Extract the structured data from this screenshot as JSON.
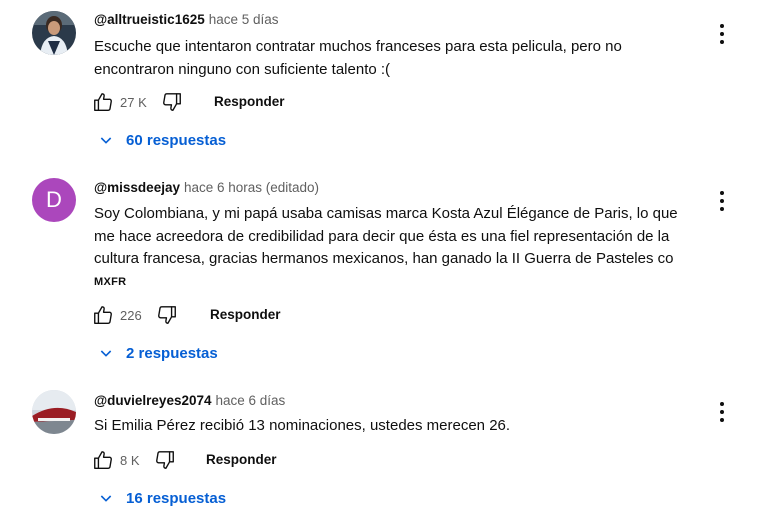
{
  "comments": [
    {
      "author": "@alltrueistic1625",
      "time": "hace 5 días",
      "lines": [
        "Escuche que intentaron contratar muchos franceses para esta pelicula, pero no",
        "encontraron ninguno con suficiente talento :("
      ],
      "likes": "27 K",
      "reply_label": "Responder",
      "replies_label": "60 respuestas"
    },
    {
      "author": "@missdeejay",
      "time": "hace 6 horas (editado)",
      "avatar_letter": "D",
      "lines": [
        "Soy Colombiana, y mi papá usaba camisas marca Kosta Azul Élégance de Paris, lo que",
        "me hace acreedora de credibilidad para decir que ésta es una fiel representación de la",
        "cultura francesa, gracias hermanos mexicanos, han ganado la II Guerra de Pasteles co"
      ],
      "tag": "MXFR",
      "likes": "226",
      "reply_label": "Responder",
      "replies_label": "2 respuestas"
    },
    {
      "author": "@duvielreyes2074",
      "time": "hace 6 días",
      "lines": [
        "Si Emilia Pérez recibió 13 nominaciones, ustedes merecen 26."
      ],
      "likes": "8 K",
      "reply_label": "Responder",
      "replies_label": "16 respuestas"
    }
  ],
  "icons": {
    "like": "thumbs-up-icon",
    "dislike": "thumbs-down-icon",
    "menu": "more-vert-icon",
    "expand": "chevron-down-icon"
  },
  "colors": {
    "link_blue": "#065fd4",
    "meta_gray": "#606060",
    "avatar_purple": "#ab47bc"
  }
}
